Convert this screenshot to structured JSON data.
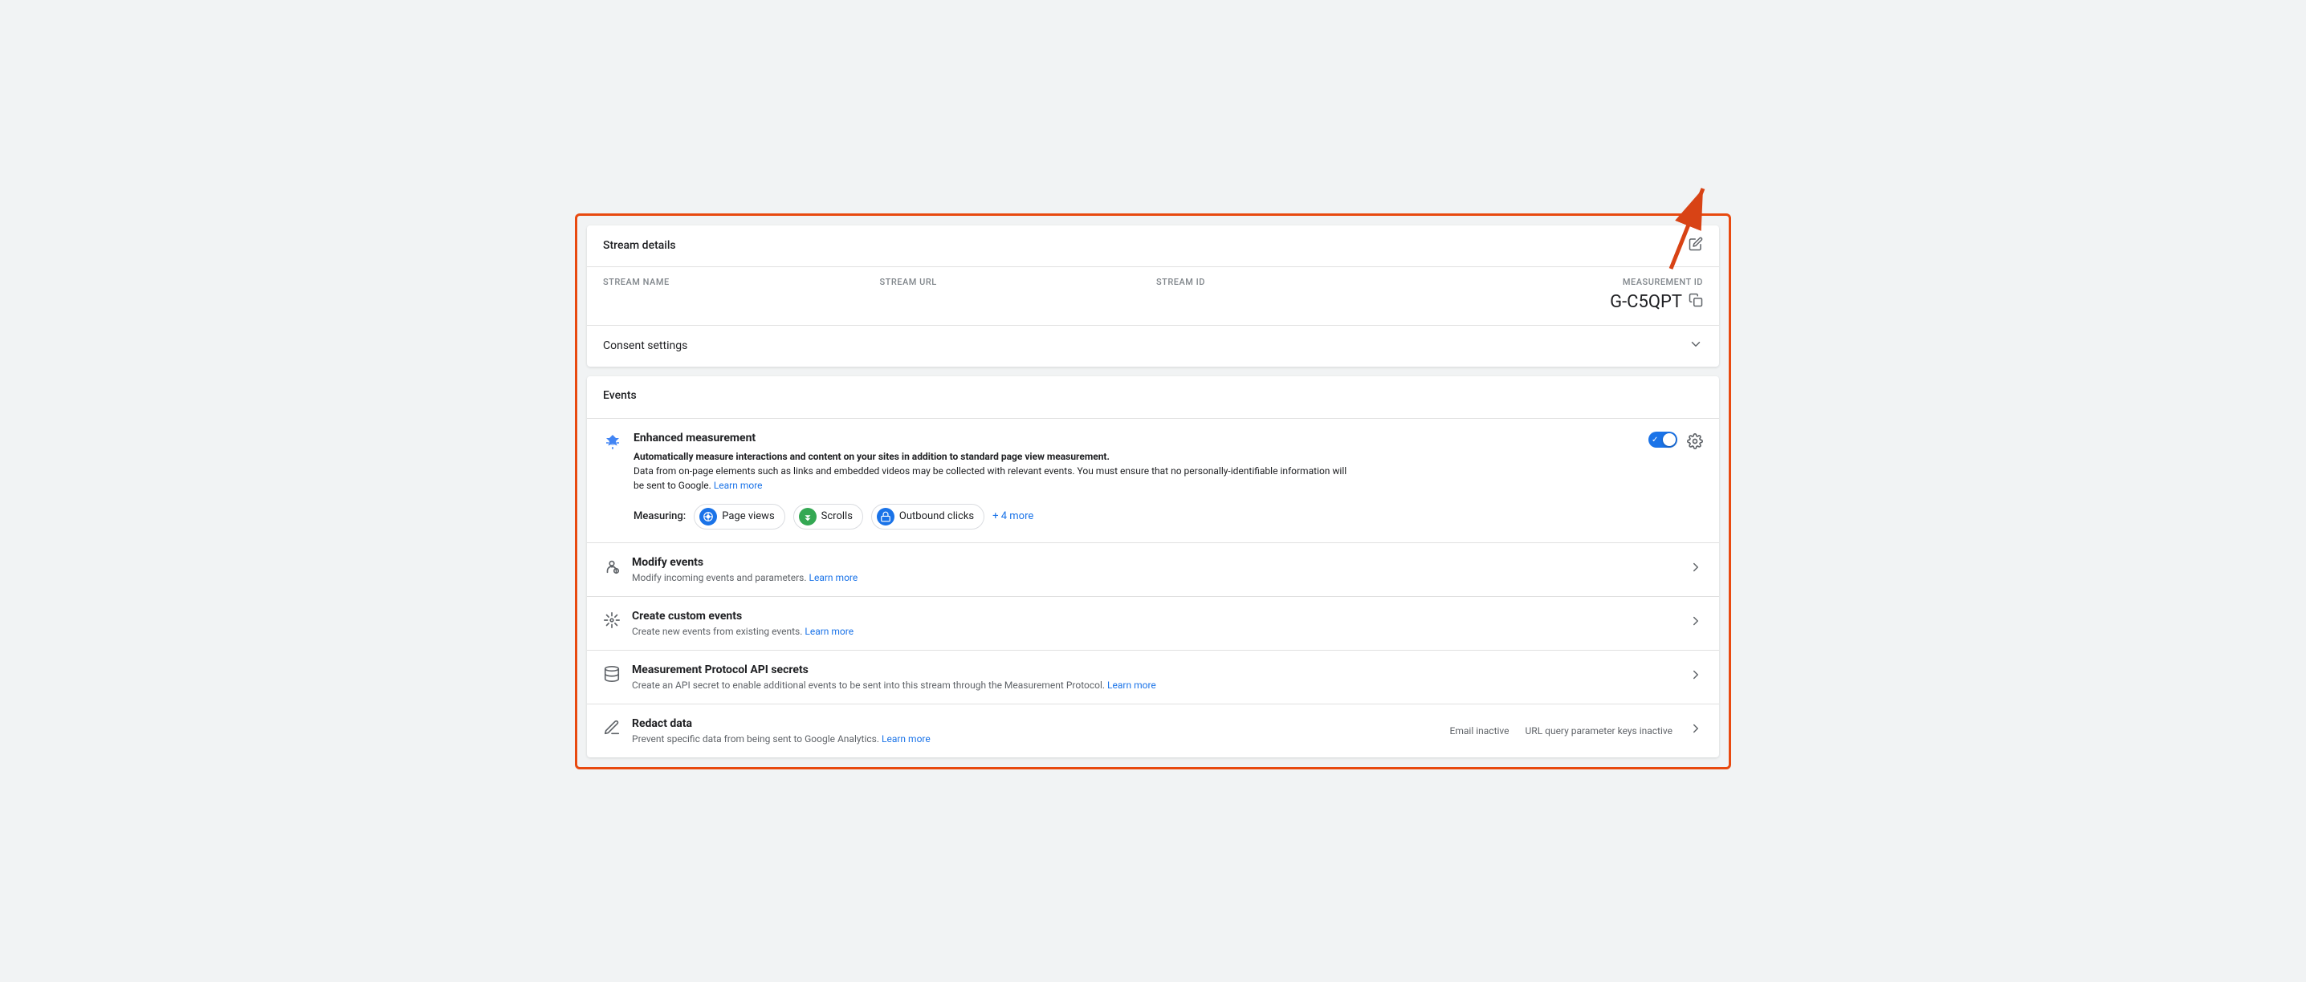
{
  "stream_details": {
    "title": "Stream details",
    "edit_icon": "✎",
    "fields": {
      "stream_name": {
        "label": "STREAM NAME",
        "value": ""
      },
      "stream_url": {
        "label": "STREAM URL",
        "value": ""
      },
      "stream_id": {
        "label": "STREAM ID",
        "value": ""
      },
      "measurement_id": {
        "label": "MEASUREMENT ID",
        "value": "G-C5QPT"
      }
    }
  },
  "consent_settings": {
    "title": "Consent settings",
    "chevron": "⌄"
  },
  "events": {
    "label": "Events",
    "enhanced_measurement": {
      "title": "Enhanced measurement",
      "description_line1": "Automatically measure interactions and content on your sites in addition to standard page view measurement.",
      "description_line2": "Data from on-page elements such as links and embedded videos may be collected with relevant events. You must ensure that no personally-identifiable information will be sent to Google.",
      "learn_more": "Learn more",
      "measuring_label": "Measuring:",
      "chips": [
        {
          "label": "Page views",
          "icon": "👁",
          "icon_color": "#1a73e8"
        },
        {
          "label": "Scrolls",
          "icon": "↕",
          "icon_color": "#34a853"
        },
        {
          "label": "Outbound clicks",
          "icon": "🔒",
          "icon_color": "#1a73e8"
        }
      ],
      "more_link": "+ 4 more",
      "toggle_on": true
    },
    "list_items": [
      {
        "id": "modify-events",
        "icon": "modify",
        "title": "Modify events",
        "description": "Modify incoming events and parameters.",
        "learn_more": "Learn more",
        "has_arrow": true,
        "status": ""
      },
      {
        "id": "create-custom-events",
        "icon": "custom",
        "title": "Create custom events",
        "description": "Create new events from existing events.",
        "learn_more": "Learn more",
        "has_arrow": true,
        "status": ""
      },
      {
        "id": "measurement-protocol",
        "icon": "protocol",
        "title": "Measurement Protocol API secrets",
        "description": "Create an API secret to enable additional events to be sent into this stream through the Measurement Protocol.",
        "learn_more": "Learn more",
        "has_arrow": true,
        "status": ""
      },
      {
        "id": "redact-data",
        "icon": "redact",
        "title": "Redact data",
        "description": "Prevent specific data from being sent to Google Analytics.",
        "learn_more": "Learn more",
        "has_arrow": true,
        "status_email": "Email inactive",
        "status_url": "URL query parameter keys inactive"
      }
    ]
  }
}
